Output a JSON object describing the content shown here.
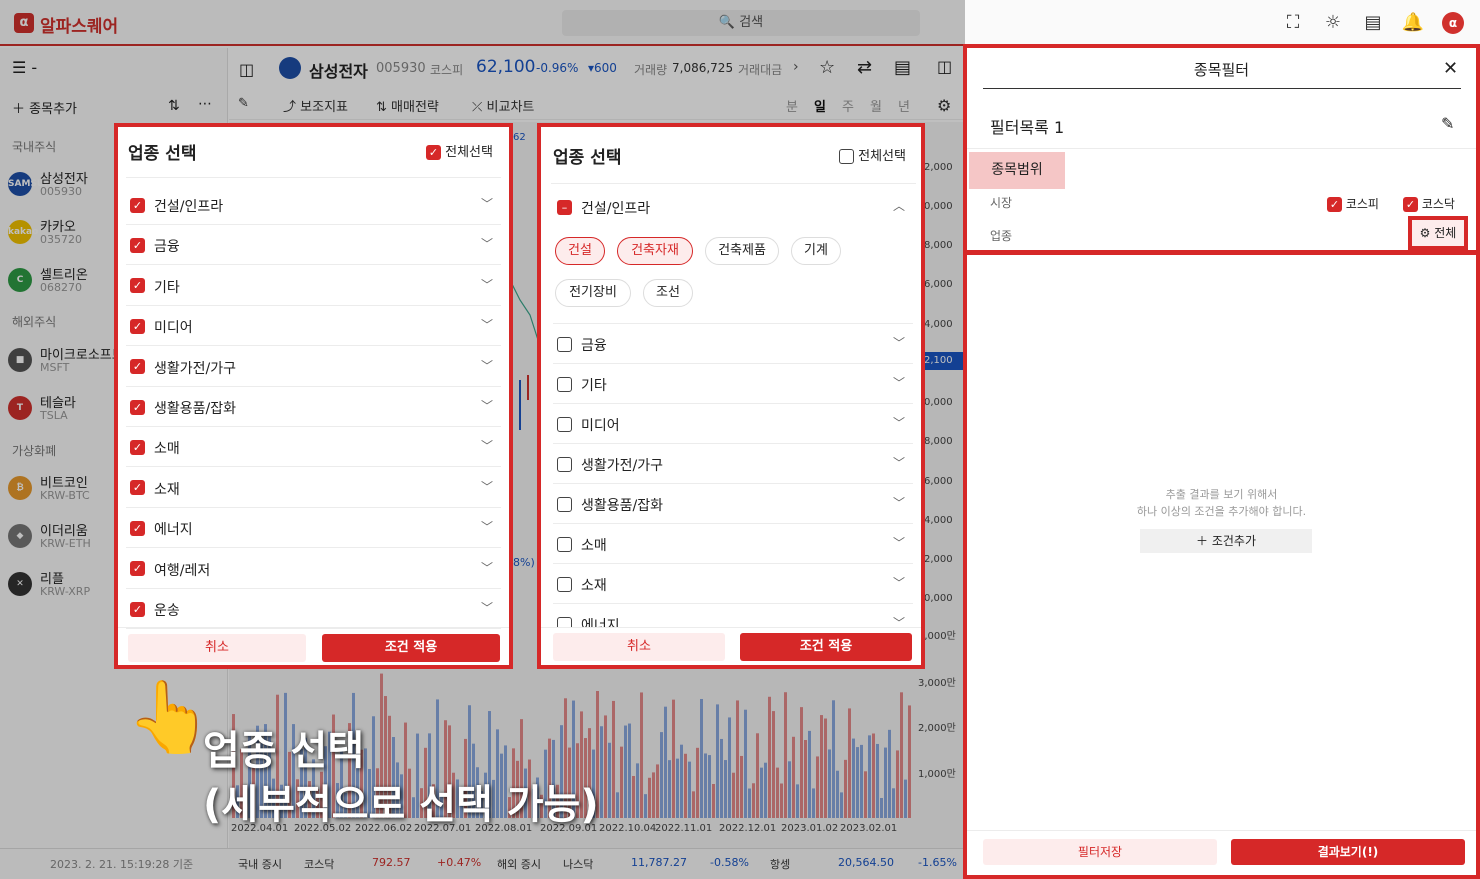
{
  "app": {
    "name": "알파스퀘어",
    "logo_char": "α"
  },
  "search": {
    "placeholder": "검색"
  },
  "leftpanel": {
    "add_label": "종목추가",
    "domestic_title": "국내주식",
    "foreign_title": "해외주식",
    "crypto_title": "가상화폐",
    "stocks": [
      {
        "name": "삼성전자",
        "code": "005930",
        "color": "#1e4fa8",
        "badge": "SAMSUNG"
      },
      {
        "name": "카카오",
        "code": "035720",
        "color": "#f2c200",
        "badge": "kakao"
      },
      {
        "name": "셀트리온",
        "code": "068270",
        "color": "#2e9b45",
        "badge": "C"
      }
    ],
    "foreign": [
      {
        "name": "마이크로소프트",
        "code": "MSFT",
        "color": "#555",
        "badge": "■"
      },
      {
        "name": "테슬라",
        "code": "TSLA",
        "color": "#d0312d",
        "badge": "T"
      }
    ],
    "crypto": [
      {
        "name": "비트코인",
        "code": "KRW-BTC",
        "color": "#e89a2c",
        "badge": "₿"
      },
      {
        "name": "이더리움",
        "code": "KRW-ETH",
        "color": "#777",
        "badge": "◆"
      },
      {
        "name": "리플",
        "code": "KRW-XRP",
        "color": "#333",
        "badge": "✕"
      }
    ]
  },
  "header": {
    "stock_name": "삼성전자",
    "stock_code": "005930",
    "market": "코스피",
    "price": "62,100",
    "change_pct": "-0.96%",
    "change_val": "▾600",
    "volume_label": "거래량",
    "volume": "7,086,725",
    "amount_label": "거래대금"
  },
  "toolbar": {
    "indicator": "보조지표",
    "strategy": "매매전략",
    "compare": "비교차트",
    "periods": [
      "분",
      "일",
      "주",
      "월",
      "년"
    ]
  },
  "chart": {
    "y_labels": [
      "2,000",
      "0,000",
      "8,000",
      "6,000",
      "4,000",
      "2,100",
      "0,000",
      "8,000",
      "6,000",
      "4,000",
      "2,000",
      "0,000"
    ],
    "vol_labels": [
      "4,000만",
      "3,000만",
      "2,000만",
      "1,000만"
    ],
    "x_labels": [
      "2022.04.01",
      "2022.05.02",
      "2022.06.02",
      "2022.07.01",
      "2022.08.01",
      "2022.09.01",
      "2022.10.04",
      "2022.11.01",
      "2022.12.01",
      "2023.01.02",
      "2023.02.01"
    ],
    "partial_label_top": "62",
    "partial_label_mid": "8%)"
  },
  "statusbar": {
    "timestamp": "2023. 2. 21. 15:19:28 기준",
    "domestic": "국내 증시",
    "kosdaq": "코스닥",
    "kosdaq_val": "792.57",
    "kosdaq_chg": "+0.47%",
    "foreign": "해외 증시",
    "nasdaq": "나스닥",
    "nasdaq_val": "11,787.27",
    "nasdaq_chg": "-0.58%",
    "hangseng": "항셍",
    "hangseng_val": "20,564.50",
    "hangseng_chg": "-1.65%"
  },
  "panel1": {
    "title": "업종 선택",
    "select_all": "전체선택",
    "items": [
      "건설/인프라",
      "금융",
      "기타",
      "미디어",
      "생활가전/가구",
      "생활용품/잡화",
      "소매",
      "소재",
      "에너지",
      "여행/레저",
      "운송"
    ],
    "cancel": "취소",
    "apply": "조건 적용"
  },
  "panel2": {
    "title": "업종 선택",
    "select_all": "전체선택",
    "expanded": "건설/인프라",
    "chips": [
      {
        "label": "건설",
        "selected": true
      },
      {
        "label": "건축자재",
        "selected": true
      },
      {
        "label": "건축제품",
        "selected": false
      },
      {
        "label": "기계",
        "selected": false
      },
      {
        "label": "전기장비",
        "selected": false
      },
      {
        "label": "조선",
        "selected": false
      }
    ],
    "items": [
      "금융",
      "기타",
      "미디어",
      "생활가전/가구",
      "생활용품/잡화",
      "소매",
      "소재",
      "에너지"
    ],
    "cancel": "취소",
    "apply": "조건 적용"
  },
  "filter": {
    "title": "종목필터",
    "list_name": "필터목록 1",
    "range_tab": "종목범위",
    "market_label": "시장",
    "kospi": "코스피",
    "kosdaq": "코스닥",
    "sector_label": "업종",
    "sector_value": "전체",
    "empty_line1": "추출 결과를 보기 위해서",
    "empty_line2": "하나 이상의 조건을 추가해야 합니다.",
    "add_condition": "조건추가",
    "save": "필터저장",
    "result": "결과보기(!)"
  },
  "caption": {
    "line1": "업종 선택",
    "line2": "(세부적으로 선택 가능)"
  },
  "colors": {
    "accent": "#d62828",
    "price_blue": "#1a56c4"
  }
}
